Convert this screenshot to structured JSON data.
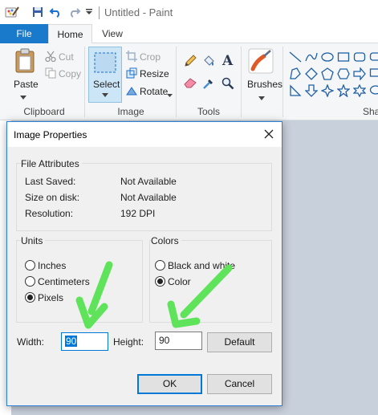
{
  "app": {
    "title": "Untitled - Paint"
  },
  "tabs": {
    "file": "File",
    "home": "Home",
    "view": "View"
  },
  "ribbon": {
    "clipboard": {
      "label": "Clipboard",
      "paste": "Paste",
      "cut": "Cut",
      "copy": "Copy"
    },
    "image": {
      "label": "Image",
      "select": "Select",
      "crop": "Crop",
      "resize": "Resize",
      "rotate": "Rotate"
    },
    "tools": {
      "label": "Tools"
    },
    "brushes": {
      "label": "Brushes"
    },
    "shapes": {
      "label": "Sha"
    }
  },
  "dialog": {
    "title": "Image Properties",
    "file_attributes": {
      "heading": "File Attributes",
      "rows": [
        {
          "label": "Last Saved:",
          "value": "Not Available"
        },
        {
          "label": "Size on disk:",
          "value": "Not Available"
        },
        {
          "label": "Resolution:",
          "value": "192 DPI"
        }
      ]
    },
    "units": {
      "heading": "Units",
      "options": [
        {
          "label": "Inches",
          "checked": false
        },
        {
          "label": "Centimeters",
          "checked": false
        },
        {
          "label": "Pixels",
          "checked": true
        }
      ]
    },
    "colors": {
      "heading": "Colors",
      "options": [
        {
          "label": "Black and white",
          "checked": false
        },
        {
          "label": "Color",
          "checked": true
        }
      ]
    },
    "width": {
      "label": "Width:",
      "value": "90"
    },
    "height": {
      "label": "Height:",
      "value": "90"
    },
    "buttons": {
      "default": "Default",
      "ok": "OK",
      "cancel": "Cancel"
    }
  },
  "colors": {
    "accent": "#0078d7",
    "file_tab": "#1979ca",
    "arrow": "#5ee35a"
  }
}
